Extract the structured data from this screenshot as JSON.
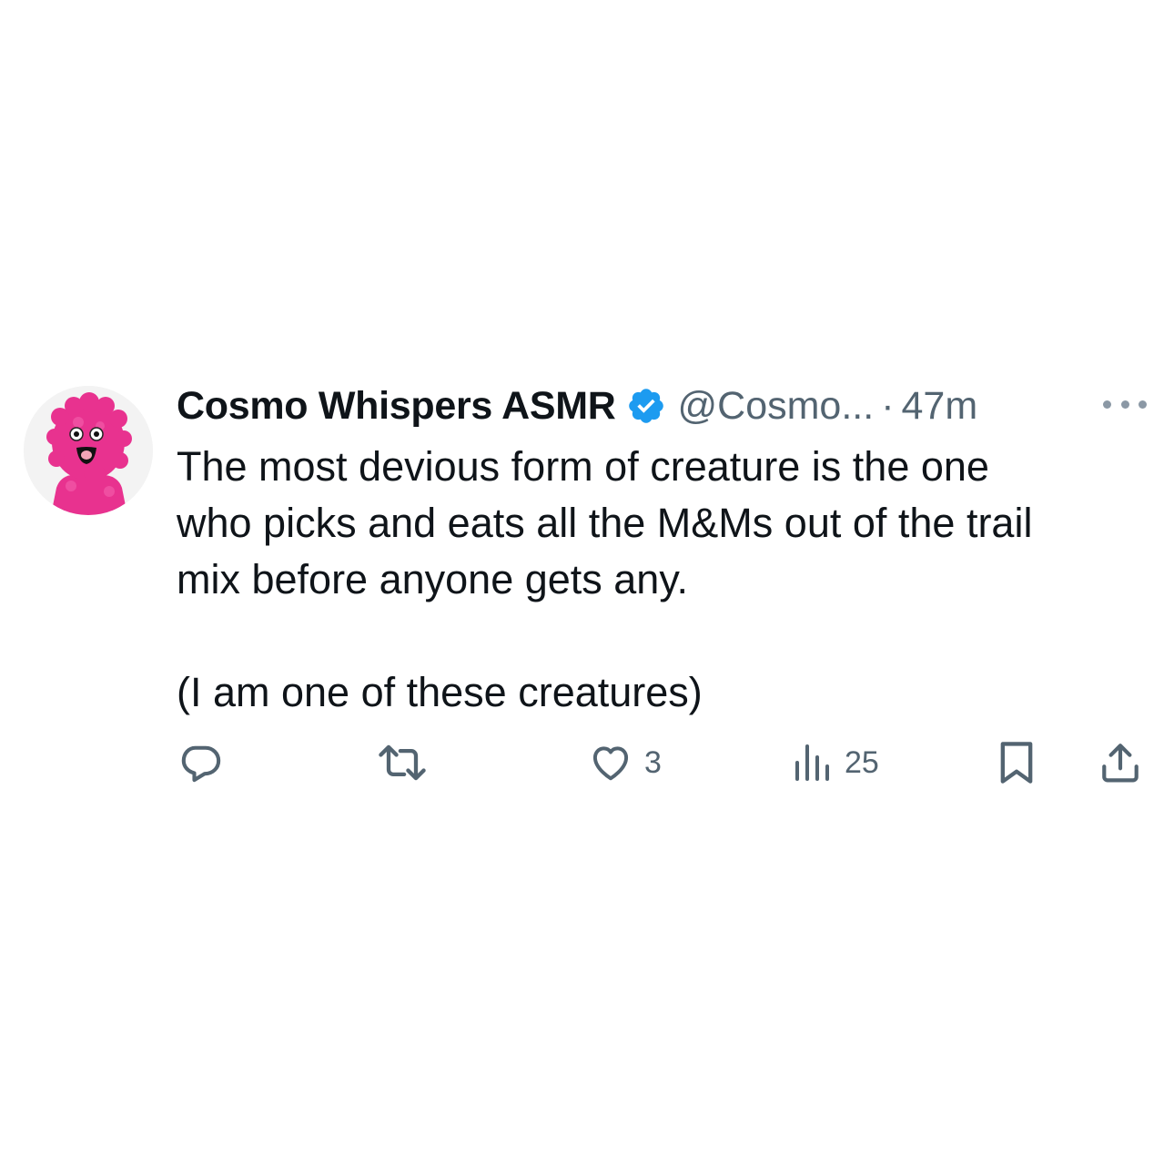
{
  "tweet": {
    "display_name": "Cosmo Whispers ASMR",
    "verified": true,
    "handle": "@Cosmo...",
    "separator": "·",
    "time": "47m",
    "text_lines": [
      "The most devious form of creature is the one",
      "who picks and eats all the M&Ms out of the trail",
      "mix before anyone gets any."
    ],
    "text_line_2": "(I am one of these creatures)"
  },
  "actions": {
    "reply_icon": "reply-icon",
    "retweet_icon": "retweet-icon",
    "like_icon": "heart-icon",
    "like_count": "3",
    "views_icon": "views-icon",
    "views_count": "25",
    "bookmark_icon": "bookmark-icon",
    "share_icon": "share-icon"
  },
  "colors": {
    "text_primary": "#0f1419",
    "text_secondary": "#536471",
    "verified_blue": "#1d9bf0",
    "avatar_pink": "#e8328f"
  }
}
